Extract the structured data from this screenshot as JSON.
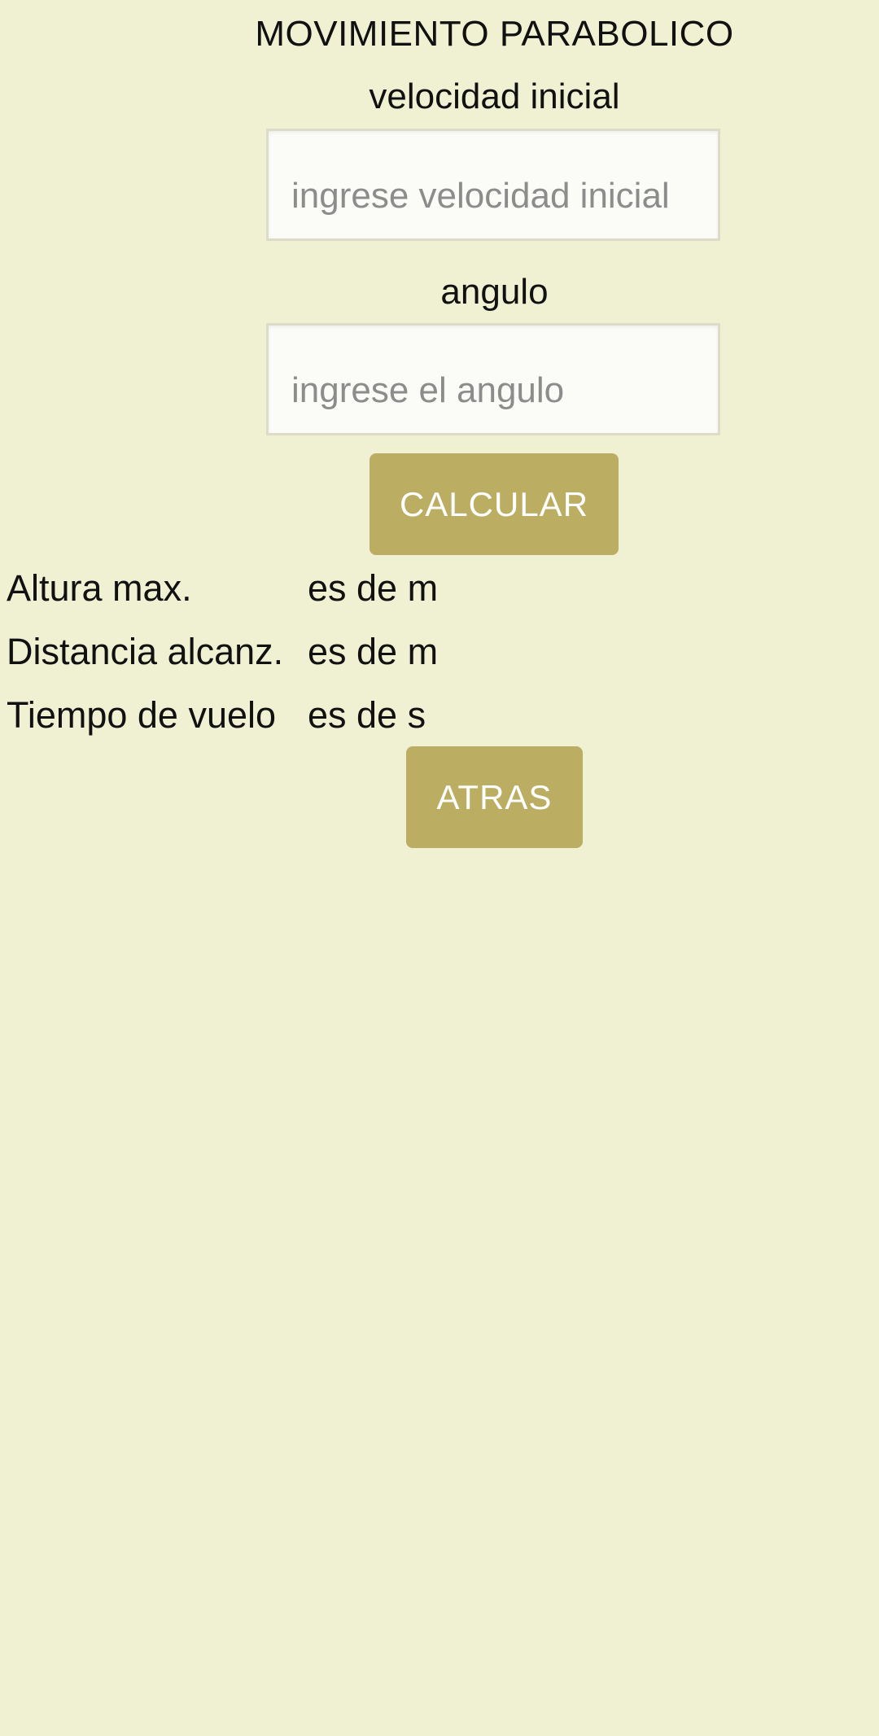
{
  "title": "MOVIMIENTO PARABOLICO",
  "velocity": {
    "label": "velocidad inicial",
    "placeholder": "ingrese velocidad inicial",
    "value": ""
  },
  "angle": {
    "label": "angulo",
    "placeholder": "ingrese el angulo",
    "value": ""
  },
  "calculate_label": "CALCULAR",
  "results": [
    {
      "label": "Altura max.",
      "value": "es de m"
    },
    {
      "label": "Distancia alcanz.",
      "value": "es de m"
    },
    {
      "label": "Tiempo de vuelo",
      "value": "es de s"
    }
  ],
  "back_label": "ATRAS",
  "colors": {
    "background": "#f0f0d3",
    "button": "#bbae63",
    "button_text": "#ffffff",
    "input_background": "#fbfbf7",
    "placeholder": "#8c8c8c"
  }
}
